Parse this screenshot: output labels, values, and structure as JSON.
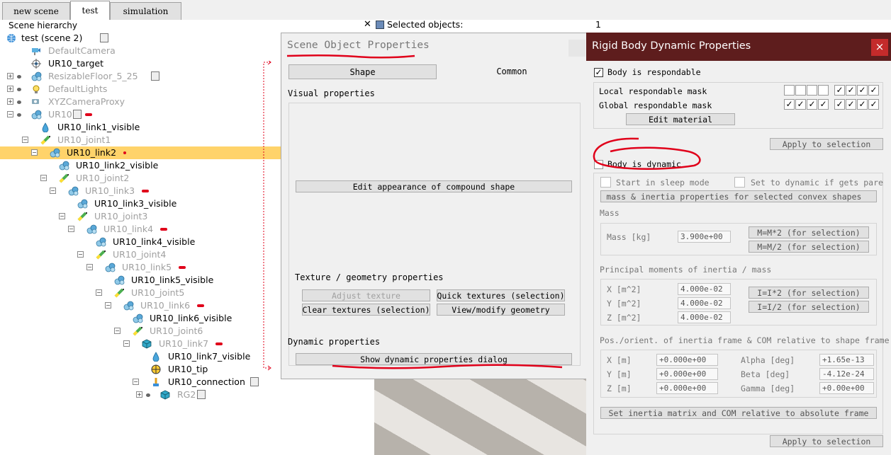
{
  "tabs": [
    "new scene",
    "test",
    "simulation"
  ],
  "hierarchy": {
    "title": "Scene hierarchy",
    "close_glyph": "✕",
    "items": [
      {
        "label": "test (scene 2)",
        "gray": false
      },
      {
        "label": "DefaultCamera",
        "gray": true
      },
      {
        "label": "UR10_target",
        "gray": false
      },
      {
        "label": "ResizableFloor_5_25",
        "gray": true
      },
      {
        "label": "DefaultLights",
        "gray": true
      },
      {
        "label": "XYZCameraProxy",
        "gray": true
      },
      {
        "label": "UR10",
        "gray": true
      },
      {
        "label": "UR10_link1_visible",
        "gray": false
      },
      {
        "label": "UR10_joint1",
        "gray": true
      },
      {
        "label": "UR10_link2",
        "gray": false
      },
      {
        "label": "UR10_link2_visible",
        "gray": false
      },
      {
        "label": "UR10_joint2",
        "gray": true
      },
      {
        "label": "UR10_link3",
        "gray": true
      },
      {
        "label": "UR10_link3_visible",
        "gray": false
      },
      {
        "label": "UR10_joint3",
        "gray": true
      },
      {
        "label": "UR10_link4",
        "gray": true
      },
      {
        "label": "UR10_link4_visible",
        "gray": false
      },
      {
        "label": "UR10_joint4",
        "gray": true
      },
      {
        "label": "UR10_link5",
        "gray": true
      },
      {
        "label": "UR10_link5_visible",
        "gray": false
      },
      {
        "label": "UR10_joint5",
        "gray": true
      },
      {
        "label": "UR10_link6",
        "gray": true
      },
      {
        "label": "UR10_link6_visible",
        "gray": false
      },
      {
        "label": "UR10_joint6",
        "gray": true
      },
      {
        "label": "UR10_link7",
        "gray": true
      },
      {
        "label": "UR10_link7_visible",
        "gray": false
      },
      {
        "label": "UR10_tip",
        "gray": false
      },
      {
        "label": "UR10_connection",
        "gray": false
      },
      {
        "label": "RG2",
        "gray": true
      }
    ]
  },
  "selected_panel": {
    "label": "Selected objects:",
    "value": "1"
  },
  "scene_object_dialog": {
    "title": "Scene Object Properties",
    "tab_shape": "Shape",
    "tab_common": "Common",
    "visual_section": "Visual properties",
    "edit_appearance": "Edit appearance of compound shape",
    "texture_section": "Texture / geometry properties",
    "adjust_texture": "Adjust texture",
    "quick_textures": "Quick textures (selection)",
    "clear_textures": "Clear textures (selection)",
    "view_geometry": "View/modify geometry",
    "dynamic_section": "Dynamic properties",
    "show_dynamic": "Show dynamic properties dialog"
  },
  "rigid_body_dialog": {
    "title": "Rigid Body Dynamic Properties",
    "close_glyph": "×",
    "body_respondable": "Body is respondable",
    "local_mask": "Local respondable mask",
    "global_mask": "Global respondable mask",
    "local_mask_bits": [
      "",
      "",
      "",
      "",
      "✓",
      "✓",
      "✓",
      "✓"
    ],
    "global_mask_bits": [
      "✓",
      "✓",
      "✓",
      "✓",
      "✓",
      "✓",
      "✓",
      "✓"
    ],
    "edit_material": "Edit material",
    "apply_selection": "Apply to selection",
    "body_dynamic": "Body is dynamic",
    "start_sleep": "Start in sleep mode",
    "set_dynamic": "Set to dynamic if gets parented",
    "compute_mass": "Compute mass & inertia properties for selected convex shapes",
    "mass_section": "Mass",
    "mass_label": "Mass [kg]",
    "mass_value": "3.900e+00",
    "mass_x2": "M=M*2  (for selection)",
    "mass_div2": "M=M/2  (for selection)",
    "inertia_section": "Principal moments of inertia / mass",
    "ix_label": "X [m^2]",
    "ix_value": "4.000e-02",
    "iy_label": "Y [m^2]",
    "iy_value": "4.000e-02",
    "iz_label": "Z [m^2]",
    "iz_value": "4.000e-02",
    "inertia_x2": "I=I*2  (for selection)",
    "inertia_div2": "I=I/2  (for selection)",
    "pos_section": "Pos./orient. of inertia frame & COM relative to shape frame",
    "px_label": "X [m]",
    "px_value": "+0.000e+00",
    "py_label": "Y [m]",
    "py_value": "+0.000e+00",
    "pz_label": "Z [m]",
    "pz_value": "+0.000e+00",
    "alpha_label": "Alpha [deg]",
    "alpha_value": "+1.65e-13",
    "beta_label": "Beta [deg]",
    "beta_value": "-4.12e-24",
    "gamma_label": "Gamma [deg]",
    "gamma_value": "+0.00e+00",
    "set_inertia": "Set inertia matrix and COM relative to absolute frame",
    "apply_selection2": "Apply to selection"
  },
  "colors": {
    "title_bar": "#5e1d1d",
    "selection": "#ffd36a",
    "annotation": "#e0001a",
    "close_button": "#c42b2b"
  }
}
